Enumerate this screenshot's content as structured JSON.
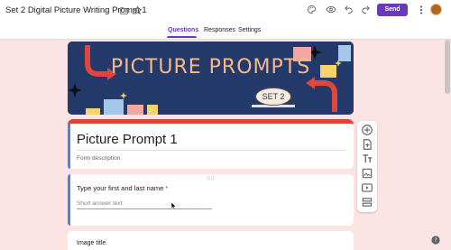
{
  "header": {
    "doc_title": "Set 2 Digital Picture Writing Prompt 1",
    "send_label": "Send"
  },
  "tabs": [
    {
      "label": "Questions",
      "active": true
    },
    {
      "label": "Responses",
      "active": false
    },
    {
      "label": "Settings",
      "active": false
    }
  ],
  "banner": {
    "title": "PICTURE PROMPTS",
    "set_label": "SET 2"
  },
  "form": {
    "title": "Picture Prompt 1",
    "description_placeholder": "Form description"
  },
  "question": {
    "text": "Type your first and last name",
    "required_marker": "*",
    "answer_hint": "Short answer text"
  },
  "image_block": {
    "title": "Image title"
  },
  "icons": {
    "folder": "folder-icon",
    "star": "star-icon",
    "palette": "palette-icon",
    "preview": "eye-icon",
    "undo": "undo-icon",
    "redo": "redo-icon",
    "more": "more-vert-icon",
    "add_question": "add-circle-icon",
    "import_questions": "import-icon",
    "add_title": "title-text-icon",
    "add_image": "image-icon",
    "add_video": "video-icon",
    "add_section": "section-icon",
    "help": "help-icon"
  },
  "colors": {
    "accent": "#673ab7",
    "background": "#fce4e4",
    "title_card_top": "#db4437",
    "focus_bar": "#4285f4",
    "banner_bg": "#233a6b"
  }
}
